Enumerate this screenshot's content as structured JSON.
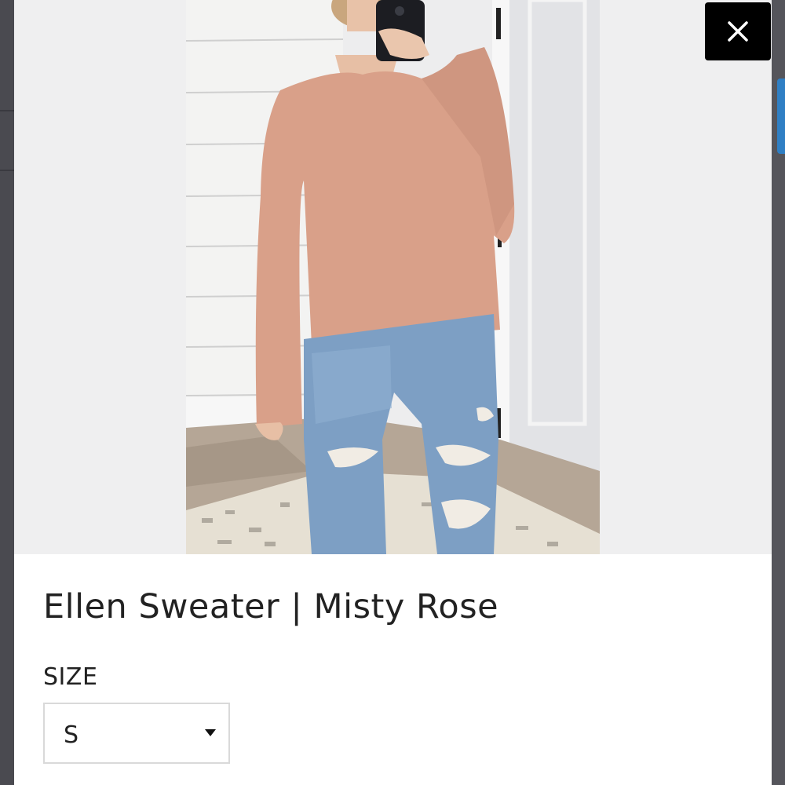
{
  "product": {
    "title": "Ellen Sweater | Misty Rose",
    "image_alt": "Woman wearing misty rose sweater and distressed jeans"
  },
  "size": {
    "label": "SIZE",
    "selected": "S"
  },
  "icons": {
    "close": "close-icon",
    "dropdown": "caret-down-icon"
  },
  "colors": {
    "close_button_bg": "#000000",
    "sweater": "#d9a089",
    "denim": "#7d9fc4",
    "accent_tab": "#2f7fc4"
  }
}
